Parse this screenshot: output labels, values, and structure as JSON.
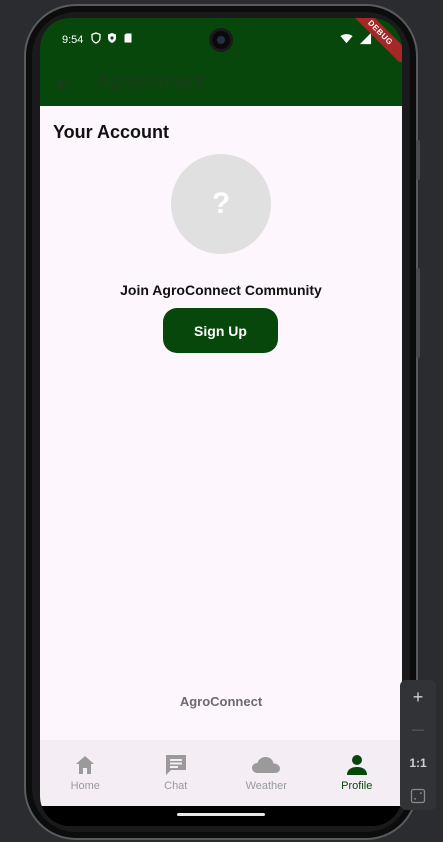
{
  "status_bar": {
    "time": "9:54",
    "debug_label": "DEBUG"
  },
  "app_bar": {
    "title": "AgroConnect"
  },
  "page": {
    "title": "Your Account",
    "avatar_glyph": "?",
    "join_text": "Join AgroConnect Community",
    "signup_label": "Sign Up",
    "footer_brand": "AgroConnect"
  },
  "bottom_nav": {
    "items": [
      {
        "label": "Home",
        "icon": "home-icon",
        "active": false
      },
      {
        "label": "Chat",
        "icon": "chat-icon",
        "active": false
      },
      {
        "label": "Weather",
        "icon": "cloud-icon",
        "active": false
      },
      {
        "label": "Profile",
        "icon": "person-icon",
        "active": true
      }
    ]
  },
  "emulator": {
    "zoom_in": "+",
    "zoom_out": "—",
    "zoom_ratio": "1:1"
  },
  "colors": {
    "primary": "#08470c",
    "background": "#fdf6fd",
    "nav_background": "#f4eef4",
    "inactive": "#9a9a9a"
  }
}
